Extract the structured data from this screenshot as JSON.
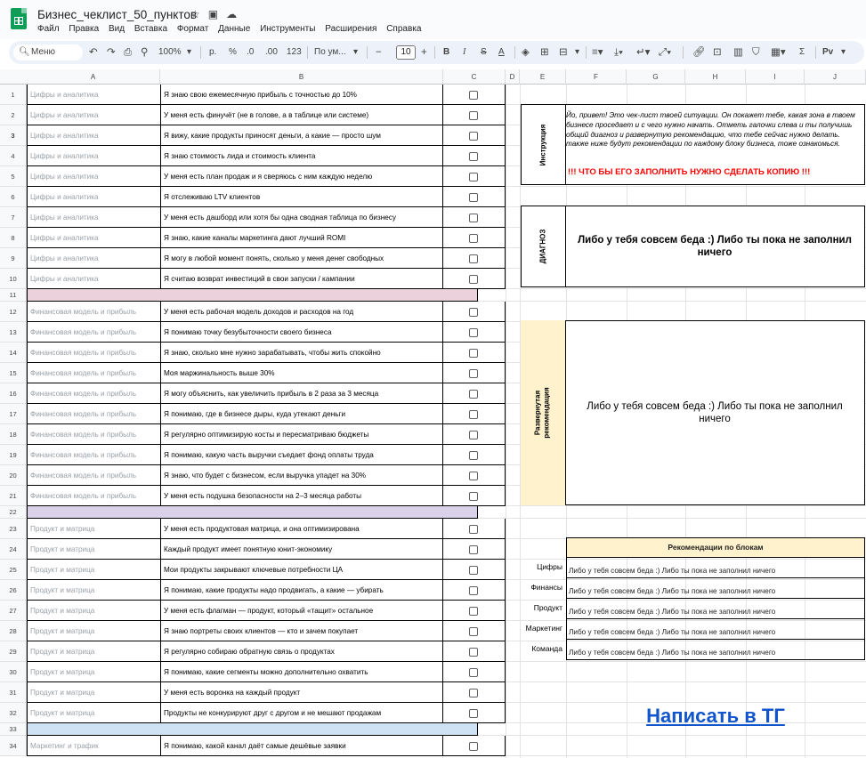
{
  "header": {
    "doc_title": "Бизнес_чеклист_50_пунктов",
    "menu": [
      "Файл",
      "Правка",
      "Вид",
      "Вставка",
      "Формат",
      "Данные",
      "Инструменты",
      "Расширения",
      "Справка"
    ]
  },
  "toolbar": {
    "search_label": "Меню",
    "zoom": "100%",
    "currency": "р.",
    "percent": "%",
    "dec_less": ".0",
    "dec_more": ".00",
    "number_format": "123",
    "font_name": "По ум...",
    "font_size": "10",
    "bold": "B",
    "italic": "I",
    "text_color": "A",
    "sum": "Σ",
    "ru_icon": "Рv"
  },
  "columns": [
    "A",
    "B",
    "C",
    "D",
    "E",
    "F",
    "G",
    "H",
    "I",
    "J"
  ],
  "rows": [
    {
      "num": "1",
      "cat": "Цифры и аналитика",
      "item": "Я знаю свою ежемесячную прибыль с точностью до 10%"
    },
    {
      "num": "2",
      "cat": "Цифры и аналитика",
      "item": "У меня есть финучёт (не в голове, а в таблице или системе)"
    },
    {
      "num": "3",
      "cat": "Цифры и аналитика",
      "item": "Я вижу, какие продукты приносят деньги, а какие — просто шум"
    },
    {
      "num": "4",
      "cat": "Цифры и аналитика",
      "item": "Я знаю стоимость лида и стоимость клиента"
    },
    {
      "num": "5",
      "cat": "Цифры и аналитика",
      "item": "У меня есть план продаж и я сверяюсь с ним каждую неделю"
    },
    {
      "num": "6",
      "cat": "Цифры и аналитика",
      "item": "Я отслеживаю LTV клиентов"
    },
    {
      "num": "7",
      "cat": "Цифры и аналитика",
      "item": "У меня есть дашборд или хотя бы одна сводная таблица по бизнесу"
    },
    {
      "num": "8",
      "cat": "Цифры и аналитика",
      "item": "Я знаю, какие каналы маркетинга дают лучший ROMI"
    },
    {
      "num": "9",
      "cat": "Цифры и аналитика",
      "item": "Я могу в любой момент понять, сколько у меня денег свободных"
    },
    {
      "num": "10",
      "cat": "Цифры и аналитика",
      "item": "Я считаю возврат инвестиций в свои запуски / кампании"
    },
    {
      "num": "11",
      "sep": "#ead1dc"
    },
    {
      "num": "12",
      "cat": "Финансовая модель и прибыль",
      "item": "У меня есть рабочая модель доходов и расходов на год"
    },
    {
      "num": "13",
      "cat": "Финансовая модель и прибыль",
      "item": "Я понимаю точку безубыточности своего бизнеса"
    },
    {
      "num": "14",
      "cat": "Финансовая модель и прибыль",
      "item": "Я знаю, сколько мне нужно зарабатывать, чтобы жить спокойно"
    },
    {
      "num": "15",
      "cat": "Финансовая модель и прибыль",
      "item": "Моя маржинальность выше 30%"
    },
    {
      "num": "16",
      "cat": "Финансовая модель и прибыль",
      "item": "Я могу объяснить, как увеличить прибыль в 2 раза за 3 месяца"
    },
    {
      "num": "17",
      "cat": "Финансовая модель и прибыль",
      "item": "Я понимаю, где в бизнесе дыры, куда утекают деньги"
    },
    {
      "num": "18",
      "cat": "Финансовая модель и прибыль",
      "item": "Я регулярно оптимизирую косты и пересматриваю бюджеты"
    },
    {
      "num": "19",
      "cat": "Финансовая модель и прибыль",
      "item": "Я понимаю, какую часть выручки съедает фонд оплаты труда"
    },
    {
      "num": "20",
      "cat": "Финансовая модель и прибыль",
      "item": "Я знаю, что будет с бизнесом, если выручка упадет на 30%"
    },
    {
      "num": "21",
      "cat": "Финансовая модель и прибыль",
      "item": "У меня есть подушка безопасности на 2–3 месяца работы"
    },
    {
      "num": "22",
      "sep": "#d9d2e9"
    },
    {
      "num": "23",
      "cat": "Продукт и матрица",
      "item": "У меня есть продуктовая матрица, и она оптимизирована"
    },
    {
      "num": "24",
      "cat": "Продукт и матрица",
      "item": "Каждый продукт имеет понятную юнит-экономику"
    },
    {
      "num": "25",
      "cat": "Продукт и матрица",
      "item": "Мои продукты закрывают ключевые потребности ЦА"
    },
    {
      "num": "26",
      "cat": "Продукт и матрица",
      "item": "Я понимаю, какие продукты надо продвигать, а какие — убирать"
    },
    {
      "num": "27",
      "cat": "Продукт и матрица",
      "item": "У меня есть флагман — продукт, который «тащит» остальное"
    },
    {
      "num": "28",
      "cat": "Продукт и матрица",
      "item": "Я знаю портреты своих клиентов — кто и зачем покупает"
    },
    {
      "num": "29",
      "cat": "Продукт и матрица",
      "item": "Я регулярно собираю обратную связь о продуктах"
    },
    {
      "num": "30",
      "cat": "Продукт и матрица",
      "item": "Я понимаю, какие сегменты можно дополнительно охватить"
    },
    {
      "num": "31",
      "cat": "Продукт и матрица",
      "item": "У меня есть воронка на каждый продукт"
    },
    {
      "num": "32",
      "cat": "Продукт и матрица",
      "item": "Продукты не конкурируют друг с другом и не мешают продажам"
    },
    {
      "num": "33",
      "sep": "#cfe2f3"
    },
    {
      "num": "34",
      "cat": "Маркетинг и трафик",
      "item": "Я понимаю, какой канал даёт самые дешёвые заявки"
    }
  ],
  "panels": {
    "intro_label": "Инструкция",
    "intro_text": "Йо, привет! Это чек-лист твоей ситуации. Он покажет тебе, какая зона в твоем бизнесе проседает и с чего нужно начать. Отметь галочки слева и ты получишь общий диагноз и развернутую рекомендацию, что тебе сейчас нужно делать. также ниже будут рекомендации по каждому блоку бизнеса, тоже ознакомься.",
    "warning": "!!! ЧТО БЫ ЕГО ЗАПОЛНИТЬ НУЖНО СДЕЛАТЬ КОПИЮ !!!",
    "diag_label": "ДИАГНОЗ",
    "diag_text": "Либо у тебя совсем беда :) Либо ты пока не заполнил ничего",
    "rec_label": "Развернутая рекомендация",
    "rec_text": "Либо у тебя совсем беда :) Либо ты пока не заполнил ничего",
    "blocks_title": "Рекомендации по блокам",
    "blocks": [
      {
        "label": "Цифры",
        "text": "Либо у тебя совсем беда :) Либо ты пока не заполнил ничего"
      },
      {
        "label": "Финансы",
        "text": "Либо у тебя совсем беда :) Либо ты пока не заполнил ничего"
      },
      {
        "label": "Продукт",
        "text": "Либо у тебя совсем беда :) Либо ты пока не заполнил ничего"
      },
      {
        "label": "Маркетинг",
        "text": "Либо у тебя совсем беда :) Либо ты пока не заполнил ничего"
      },
      {
        "label": "Команда",
        "text": "Либо у тебя совсем беда :) Либо ты пока не заполнил ничего"
      }
    ],
    "tg_link": "Написать в ТГ"
  },
  "colors": {
    "accent_green": "#0f9d58",
    "label_bg": "#fff2cc",
    "link": "#1155cc",
    "warning": "#ff0000"
  }
}
